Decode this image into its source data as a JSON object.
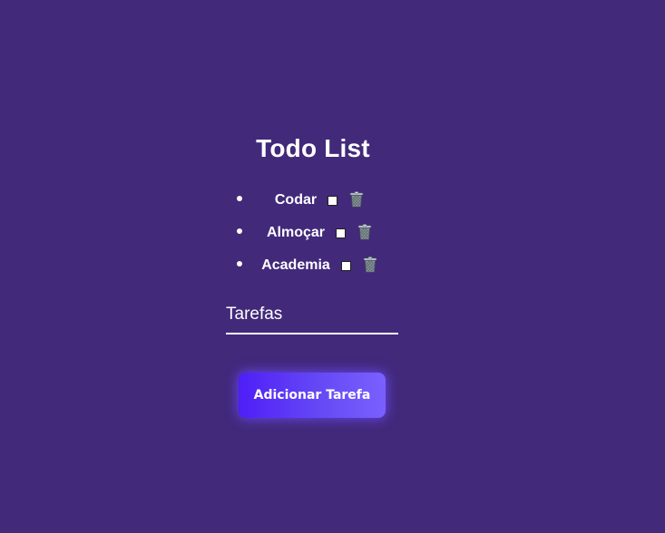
{
  "app": {
    "title": "Todo List"
  },
  "tasks": [
    {
      "label": "Codar",
      "done": false
    },
    {
      "label": "Almoçar",
      "done": false
    },
    {
      "label": "Academia",
      "done": false
    }
  ],
  "input": {
    "placeholder": "Tarefas",
    "value": ""
  },
  "actions": {
    "add_label": "Adicionar Tarefa"
  },
  "icons": {
    "delete": "trash-icon",
    "complete": "checkbox-icon"
  },
  "colors": {
    "background": "#42297a",
    "button_start": "#4f1ef8",
    "button_end": "#7a60ff",
    "text": "#ffffff"
  }
}
